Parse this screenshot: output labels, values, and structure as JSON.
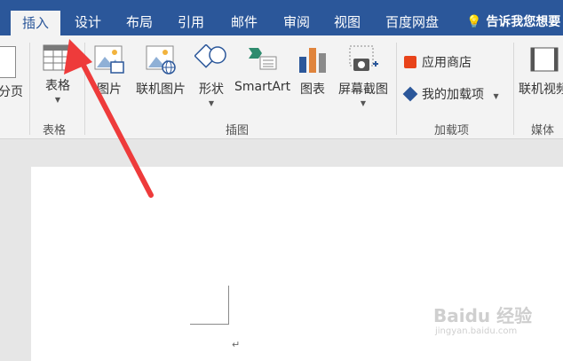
{
  "tabs": [
    "插入",
    "设计",
    "布局",
    "引用",
    "邮件",
    "审阅",
    "视图",
    "百度网盘"
  ],
  "tell_me": "告诉我您想要",
  "ribbon": {
    "partial_left": "分页",
    "table": {
      "label": "表格",
      "group": "表格"
    },
    "illustrations": {
      "items": [
        "图片",
        "联机图片",
        "形状",
        "SmartArt",
        "图表",
        "屏幕截图"
      ],
      "group": "插图"
    },
    "addins": {
      "store": "应用商店",
      "my": "我的加载项",
      "group": "加载项"
    },
    "media": {
      "item": "联机视频",
      "group": "媒体"
    }
  },
  "document": {
    "para_mark": "↵"
  },
  "watermark": {
    "brand": "Baidu 经验",
    "url": "jingyan.baidu.com"
  },
  "colors": {
    "accent": "#2b579a",
    "arrow": "#ee3b3b"
  }
}
